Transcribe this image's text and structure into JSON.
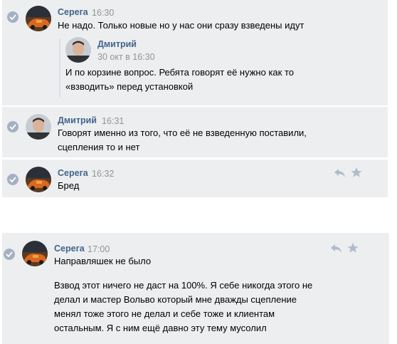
{
  "messages": [
    {
      "author": "Серега",
      "time": "16:30",
      "text": "Не надо. Только новые но у нас они сразу взведены идут",
      "quote": {
        "author": "Дмитрий",
        "date": "30 окт в 16:30",
        "text": "И по корзине вопрос. Ребята говорят её нужно как то\n«взводить» перед установкой"
      }
    },
    {
      "author": "Дмитрий",
      "time": "16:31",
      "text": "Говорят именно из того, что её не взведенную поставили,\nсцепления то и нет"
    },
    {
      "author": "Серега",
      "time": "16:32",
      "text": "Бред"
    },
    {
      "author": "Серега",
      "time": "17:00",
      "text": "Направляшек не было",
      "text2": "Взвод этот ничего не даст на 100%. Я себе никогда этого не\nделал и мастер Вольво который мне дважды сцепление\nменял тоже этого не делал и себе тоже и клиентам\nостальным. Я с ним ещё давно эту тему мусолил"
    }
  ],
  "colors": {
    "background": "#edeef0",
    "author": "#42648b",
    "meta": "#939393",
    "check": "#a5b1c2",
    "actions": "#b0bccb"
  },
  "icons": [
    "check-icon",
    "reply-icon",
    "star-icon"
  ]
}
